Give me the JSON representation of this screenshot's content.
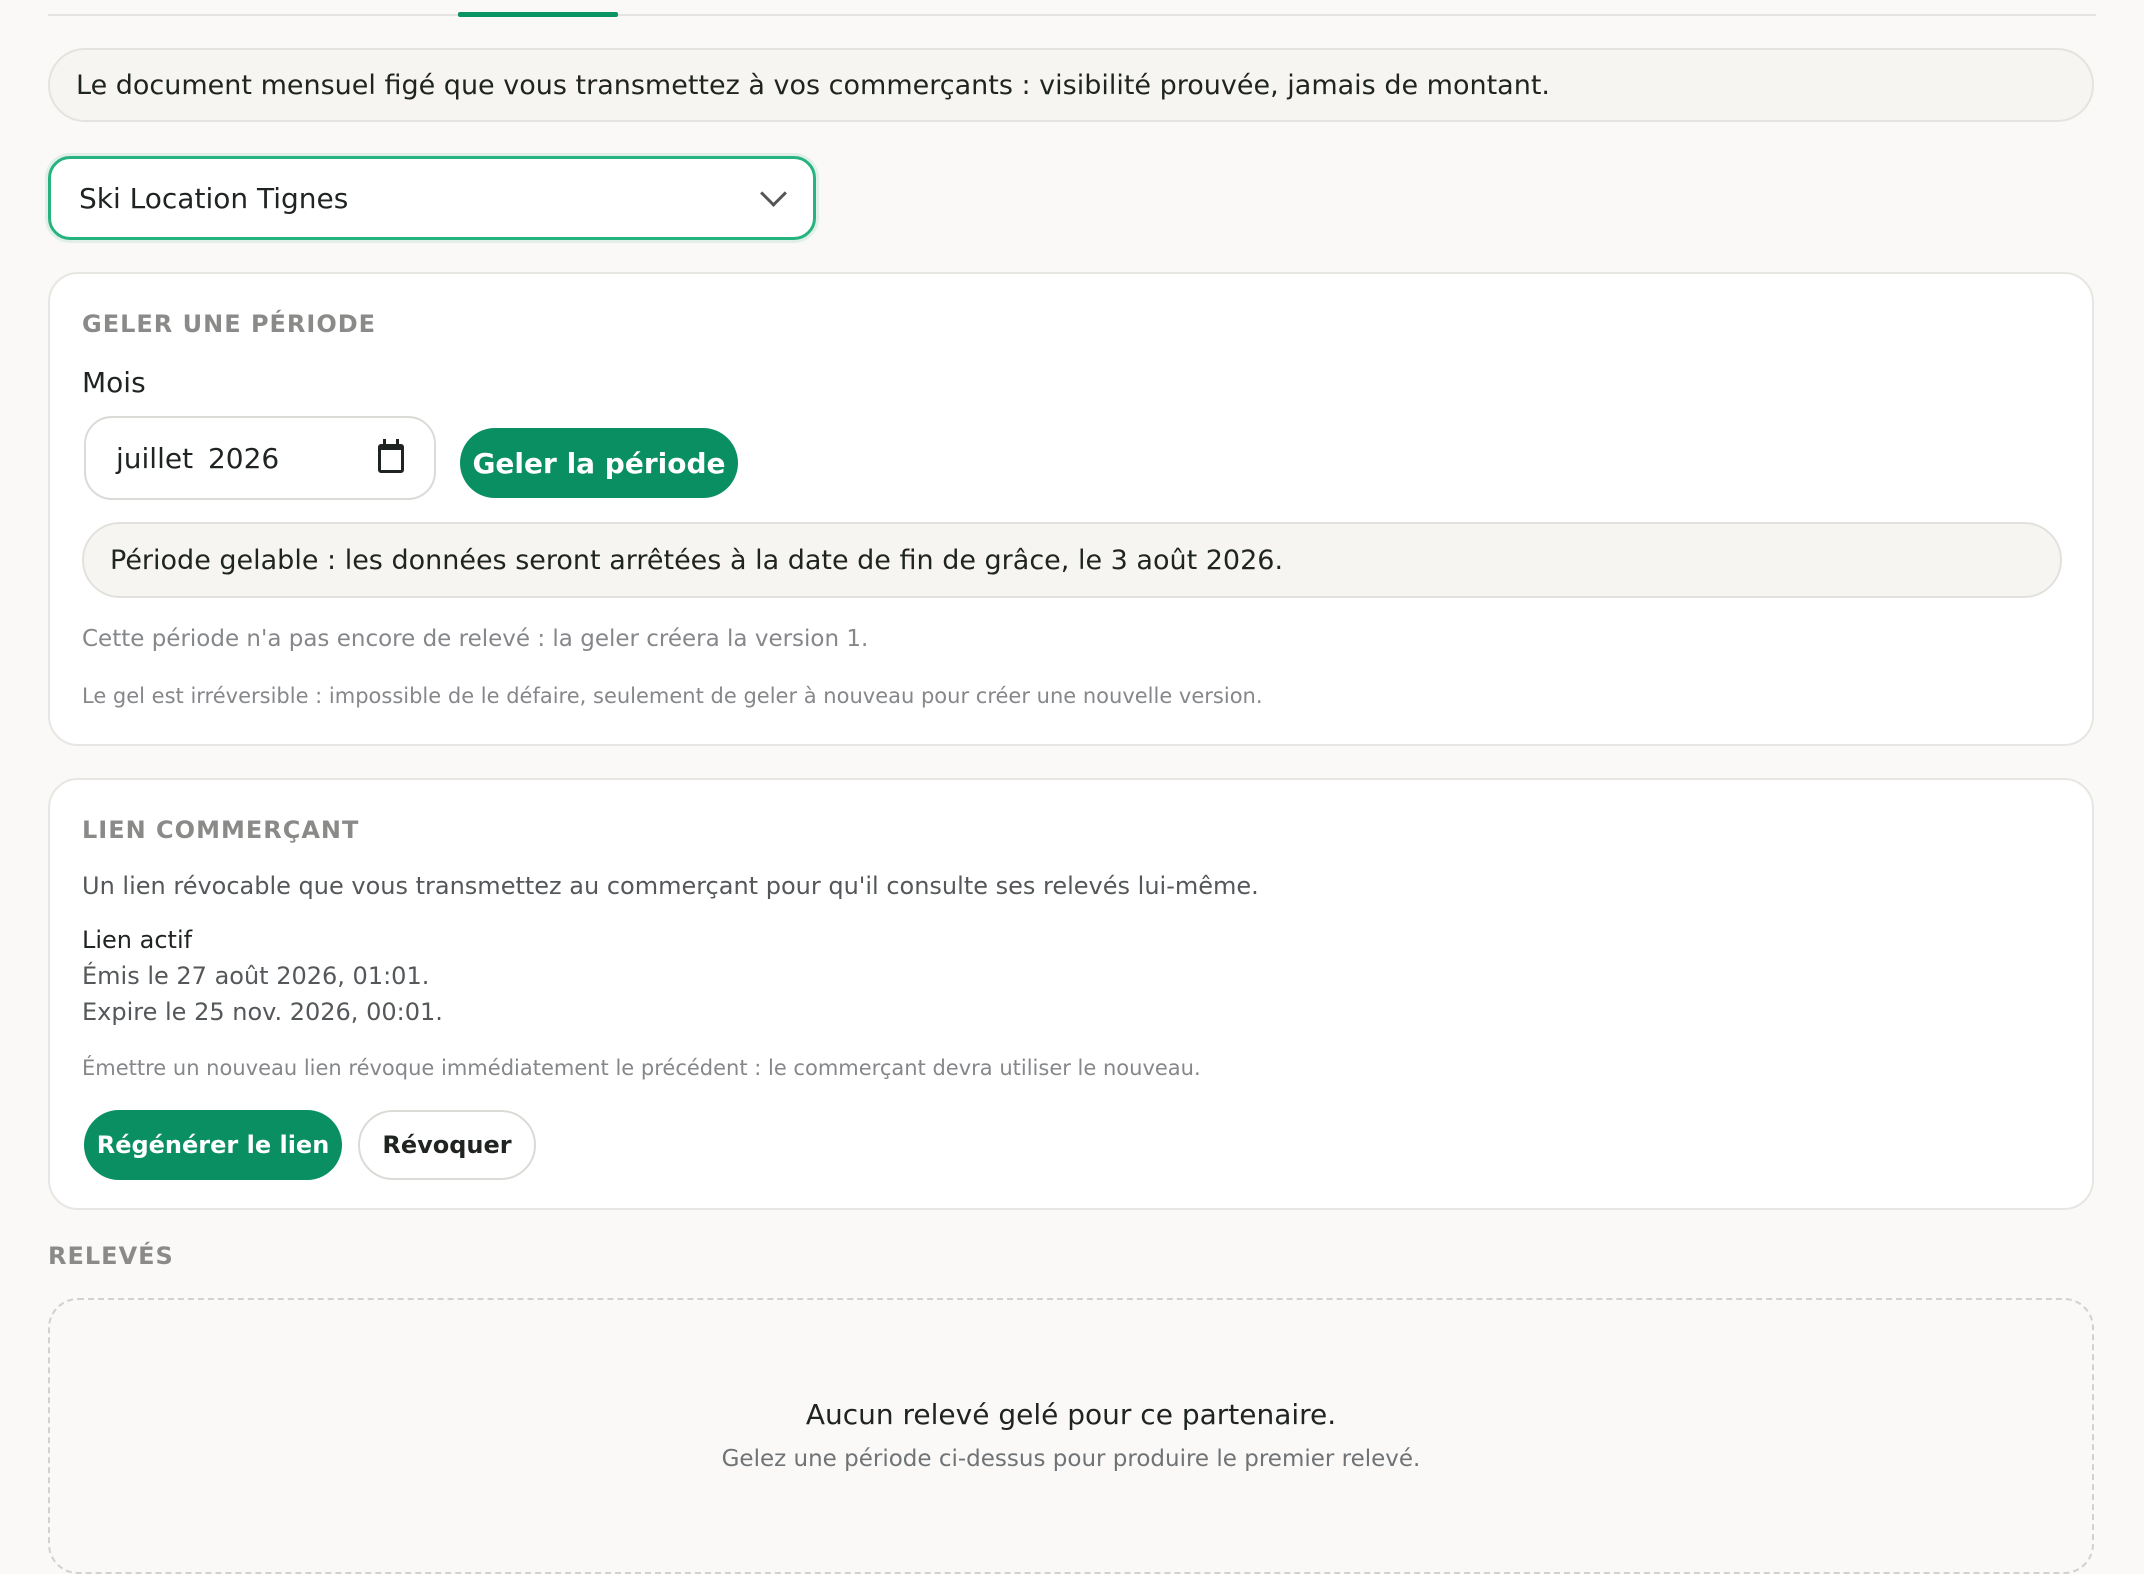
{
  "intro": {
    "text": "Le document mensuel figé que vous transmettez à vos commerçants : visibilité prouvée, jamais de montant."
  },
  "partner_select": {
    "value": "Ski Location Tignes"
  },
  "periode": {
    "title": "GELER UNE PÉRIODE",
    "month_label": "Mois",
    "month_value": "juillet 2026",
    "freeze_button": "Geler la période",
    "notice": "Période gelable : les données seront arrêtées à la date de fin de grâce, le 3 août 2026.",
    "info": "Cette période n'a pas encore de relevé : la geler créera la version 1.",
    "warning": "Le gel est irréversible : impossible de le défaire, seulement de geler à nouveau pour créer une nouvelle version."
  },
  "lien": {
    "title": "LIEN COMMERÇANT",
    "description": "Un lien révocable que vous transmettez au commerçant pour qu'il consulte ses relevés lui-même.",
    "status": "Lien actif",
    "issued": "Émis le 27 août 2026, 01:01.",
    "expires": "Expire le 25 nov. 2026, 00:01.",
    "note": "Émettre un nouveau lien révoque immédiatement le précédent : le commerçant devra utiliser le nouveau.",
    "regenerate_button": "Régénérer le lien",
    "revoke_button": "Révoquer"
  },
  "releves": {
    "title": "RELEVÉS",
    "empty_title": "Aucun relevé gelé pour ce partenaire.",
    "empty_subtitle": "Gelez une période ci-dessus pour produire le premier relevé."
  },
  "colors": {
    "accent": "#0a8f62",
    "focus_border": "#27b380",
    "background": "#faf9f7"
  }
}
